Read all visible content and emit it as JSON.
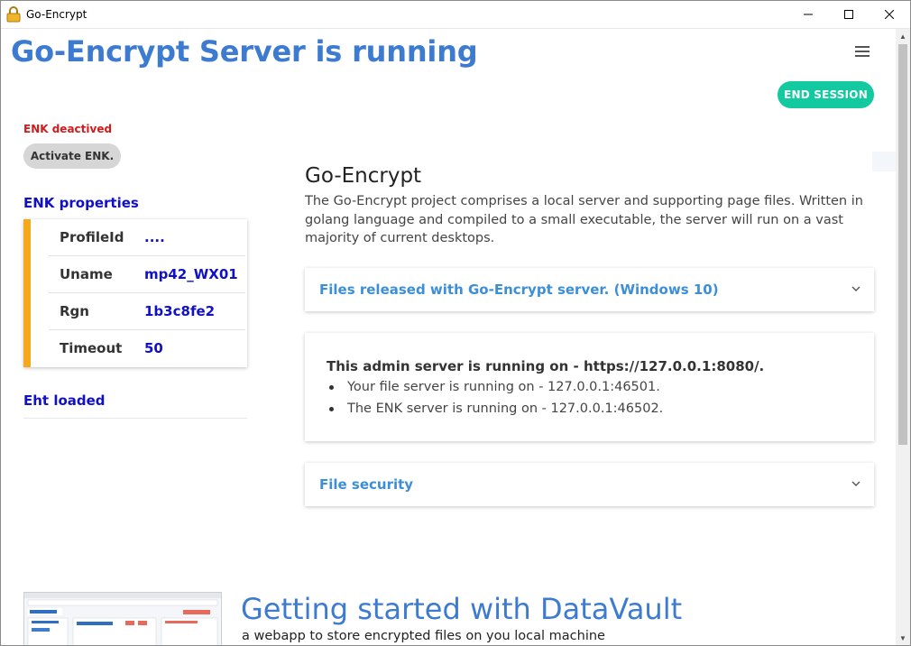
{
  "window": {
    "title": "Go-Encrypt",
    "icon": "lock-icon"
  },
  "header": {
    "title": "Go-Encrypt Server is running",
    "menu_icon": "hamburger-menu-icon",
    "end_session_label": "END SESSION"
  },
  "sidebar": {
    "enk_status": "ENK deactived",
    "enk_status_color": "#d31a1a",
    "activate_label": "Activate ENK.",
    "props_title": "ENK properties",
    "props": [
      {
        "key": "ProfileId",
        "value": "...."
      },
      {
        "key": "Uname",
        "value": "mp42_WX01"
      },
      {
        "key": "Rgn",
        "value": "1b3c8fe2"
      },
      {
        "key": "Timeout",
        "value": "50"
      }
    ],
    "eht_status": "Eht loaded"
  },
  "main": {
    "title": "Go-Encrypt",
    "description": "The Go-Encrypt project comprises a local server and supporting page files. Written in golang language and compiled to a small executable, the server will run on a vast majority of current desktops.",
    "files_accordion": "Files released with Go-Encrypt server. (Windows 10)",
    "server_info": {
      "heading": "This admin server is running on - https://127.0.0.1:8080/.",
      "items": [
        "Your file server is running on - 127.0.0.1:46501.",
        "The ENK server is running on - 127.0.0.1:46502."
      ]
    },
    "security_accordion": "File security"
  },
  "getting_started": {
    "title": "Getting started with DataVault",
    "subtitle": "a webapp to store encrypted files on you local machine"
  },
  "colors": {
    "title_blue": "#3d7bd1",
    "accent_teal": "#13c9a0",
    "card_accent": "#f5a81b",
    "value_blue": "#1010c8",
    "link_blue": "#3c8ed6"
  }
}
